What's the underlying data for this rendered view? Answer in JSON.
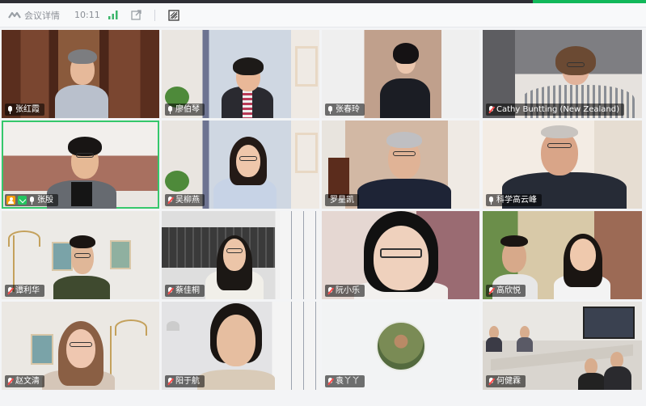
{
  "toolbar": {
    "meeting_details_label": "会议详情",
    "time": "10:11"
  },
  "participants": [
    {
      "name": "张红霞",
      "mic": "on"
    },
    {
      "name": "廖伯琴",
      "mic": "on"
    },
    {
      "name": "张春玲",
      "mic": "on"
    },
    {
      "name": "Cathy Buntting (New Zealand)",
      "mic": "off"
    },
    {
      "name": "张殷",
      "mic": "on",
      "host": true,
      "active": true
    },
    {
      "name": "吴柳燕",
      "mic": "off"
    },
    {
      "name": "罗星凯",
      "mic": "none"
    },
    {
      "name": "科学高云峰",
      "mic": "on"
    },
    {
      "name": "谭利华",
      "mic": "off"
    },
    {
      "name": "蔡佳桐",
      "mic": "off"
    },
    {
      "name": "阮小乐",
      "mic": "off"
    },
    {
      "name": "高欣悦",
      "mic": "off"
    },
    {
      "name": "赵文清",
      "mic": "off"
    },
    {
      "name": "阳于航",
      "mic": "off"
    },
    {
      "name": "袁丫丫",
      "mic": "off"
    },
    {
      "name": "何健霖",
      "mic": "off"
    }
  ],
  "colors": {
    "active_border": "#35c76b",
    "host_badge": "#f59e0b",
    "mic_muted": "#ff4a4a"
  }
}
